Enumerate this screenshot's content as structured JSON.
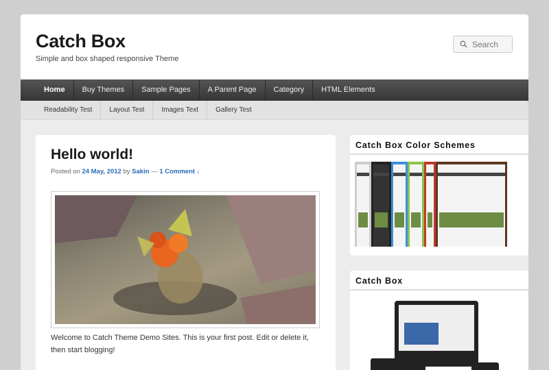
{
  "header": {
    "title": "Catch Box",
    "description": "Simple and box shaped responsive Theme",
    "search_placeholder": "Search"
  },
  "nav": {
    "items": [
      "Home",
      "Buy Themes",
      "Sample Pages",
      "A Parent Page",
      "Category",
      "HTML Elements"
    ],
    "active": "Home"
  },
  "subnav": {
    "items": [
      "Readability Test",
      "Layout Test",
      "Images Text",
      "Gallery Test"
    ]
  },
  "post": {
    "title": "Hello world!",
    "meta_prefix": "Posted on",
    "date": "24 May, 2012",
    "by": "by",
    "author": "Sakin",
    "separator": "—",
    "comments": "1 Comment ↓",
    "body": "Welcome to Catch Theme Demo Sites. This is your first post. Edit or delete it, then start blogging!"
  },
  "sidebar": {
    "widgets": [
      {
        "title": "Catch Box Color Schemes"
      },
      {
        "title": "Catch Box"
      }
    ]
  },
  "colors": {
    "nav": "#3f3f3f",
    "link": "#2a6cb5",
    "schemes": [
      "#e0e0e0",
      "#222222",
      "#3b8fd9",
      "#8bc34a",
      "#c0392b",
      "#5a3620"
    ]
  }
}
